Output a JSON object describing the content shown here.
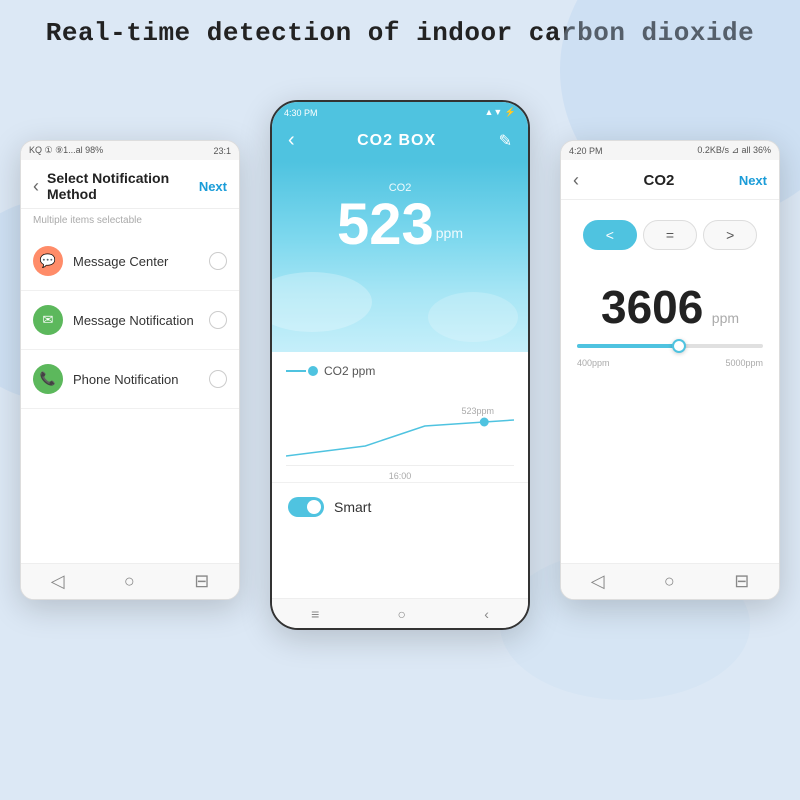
{
  "header": {
    "title": "Real-time detection of indoor carbon dioxide"
  },
  "phone_left": {
    "status_bar": {
      "left": "KQ ① ⑨1...al 98%",
      "right": "23:1"
    },
    "nav": {
      "back": "‹",
      "title": "Select Notification Method",
      "next": "Next"
    },
    "subtitle": "Multiple items selectable",
    "items": [
      {
        "label": "Message Center",
        "icon": "💬",
        "icon_type": "msg"
      },
      {
        "label": "Message Notification",
        "icon": "✉",
        "icon_type": "email"
      },
      {
        "label": "Phone Notification",
        "icon": "📞",
        "icon_type": "phone"
      }
    ]
  },
  "phone_center": {
    "status_bar": {
      "time": "4:30 PM",
      "right": "▲ ▼ ⚡"
    },
    "nav": {
      "back": "‹",
      "title": "CO2 BOX",
      "edit": "✎"
    },
    "co2": {
      "label": "CO2",
      "value": "523",
      "unit": "ppm"
    },
    "chart": {
      "label": "CO2 ppm",
      "value_label": "523ppm",
      "time_label": "16:00"
    },
    "smart": {
      "label": "Smart"
    }
  },
  "phone_right": {
    "status_bar": {
      "left": "4:20 PM",
      "right": "0.2KB/s ⊿ all 36%"
    },
    "nav": {
      "back": "‹",
      "title": "CO2",
      "next": "Next"
    },
    "operators": [
      "<",
      "=",
      ">"
    ],
    "value": "3606",
    "unit": "ppm",
    "slider": {
      "min": "400ppm",
      "max": "5000ppm"
    }
  },
  "icons": {
    "back_arrow": "‹",
    "edit_icon": "✎",
    "nav_home": "⊟",
    "nav_back": "◁",
    "nav_recent": "○"
  }
}
